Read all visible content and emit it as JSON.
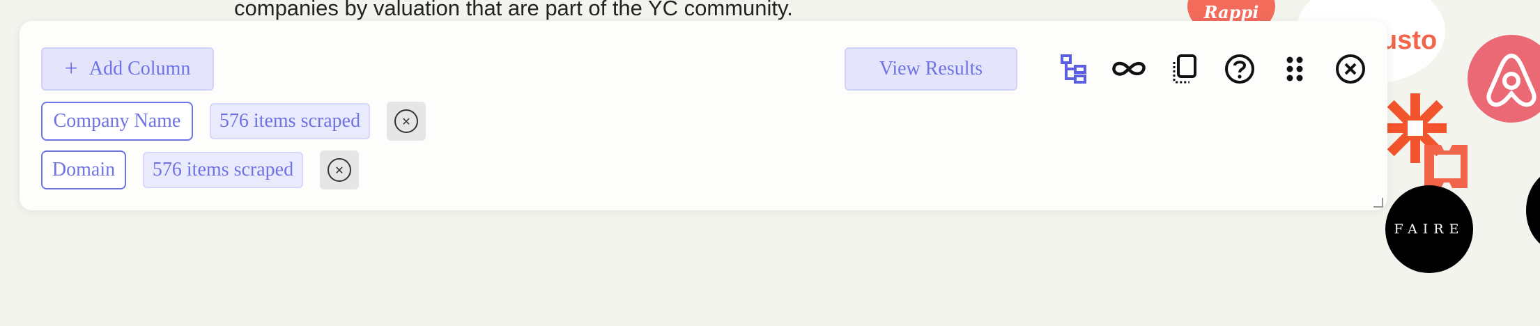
{
  "background": {
    "intro_text": "companies by valuation that are part of the YC community.",
    "logos": {
      "rappi": "Rappi",
      "gusto": "usto",
      "faire": "FAIRE"
    }
  },
  "toolbar": {
    "add_column_label": "Add Column",
    "view_results_label": "View Results",
    "icons": [
      "tree-icon",
      "infinity-icon",
      "copy-page-icon",
      "help-icon",
      "drag-handle-icon",
      "close-icon"
    ],
    "accent_color": "#6e72e3",
    "icon_accent": "#5b5ee0"
  },
  "columns": [
    {
      "name": "Company Name",
      "status": "576 items scraped"
    },
    {
      "name": "Domain",
      "status": "576 items scraped"
    }
  ]
}
